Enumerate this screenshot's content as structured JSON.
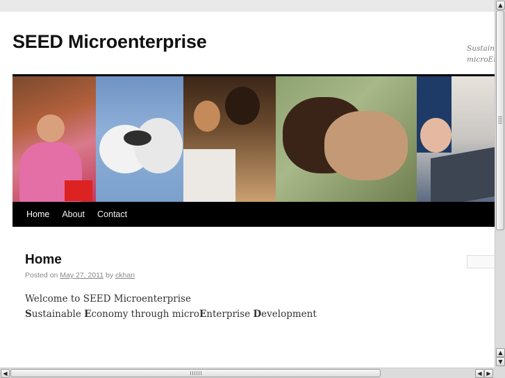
{
  "site": {
    "title": "SEED Microenterprise",
    "description_line1": "Sustainab",
    "description_line2": "microEn"
  },
  "nav": {
    "items": [
      {
        "label": "Home"
      },
      {
        "label": "About"
      },
      {
        "label": "Contact"
      }
    ]
  },
  "post": {
    "title": "Home",
    "meta_prefix": "Posted on",
    "date": "May 27, 2011",
    "by": "by",
    "author": "ckhan",
    "line1": "Welcome to SEED Microenterprise",
    "line2_parts": [
      {
        "text": "S",
        "bold": true
      },
      {
        "text": "ustainable ",
        "bold": false
      },
      {
        "text": "E",
        "bold": true
      },
      {
        "text": "conomy through micro",
        "bold": false
      },
      {
        "text": "E",
        "bold": true
      },
      {
        "text": "nterprise ",
        "bold": false
      },
      {
        "text": "D",
        "bold": true
      },
      {
        "text": "evelopment",
        "bold": false
      }
    ]
  },
  "search": {
    "placeholder": ""
  },
  "icons": {
    "scroll_up": "arrow-up-icon",
    "scroll_down": "arrow-down-icon",
    "scroll_left": "arrow-left-icon",
    "scroll_right": "arrow-right-icon"
  },
  "colors": {
    "nav_bg": "#000000",
    "title_text": "#111111",
    "meta_text": "#888888",
    "body_text": "#333333"
  }
}
